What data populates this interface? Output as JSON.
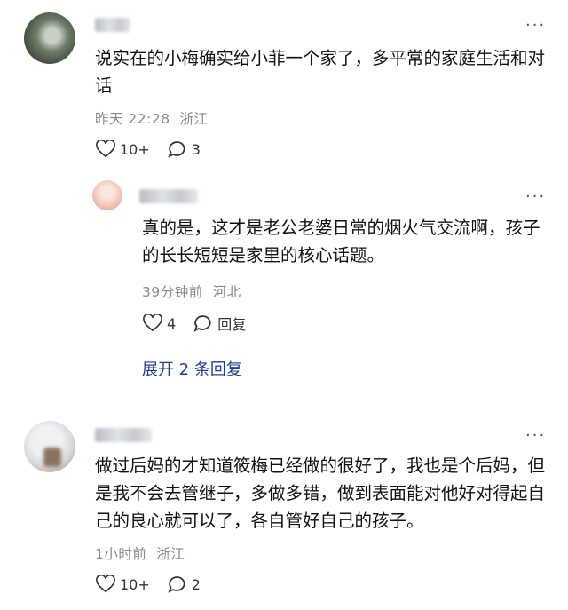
{
  "comments": [
    {
      "text": "说实在的小梅确实给小菲一个家了，多平常的家庭生活和对话",
      "time": "昨天 22:28",
      "location": "浙江",
      "likes": "10+",
      "replies": "3"
    },
    {
      "text": "真的是，这才是老公老婆日常的烟火气交流啊，孩子的长长短短是家里的核心话题。",
      "time": "39分钟前",
      "location": "河北",
      "likes": "4",
      "reply_label": "回复"
    },
    {
      "text": "做过后妈的才知道筱梅已经做的很好了，我也是个后妈，但是我不会去管继子，多做多错，做到表面能对他好对得起自己的良心就可以了，各自管好自己的孩子。",
      "time": "1小时前",
      "location": "浙江",
      "likes": "10+",
      "replies": "2"
    }
  ],
  "expand_label": "展开 2 条回复",
  "more_glyph": "···"
}
